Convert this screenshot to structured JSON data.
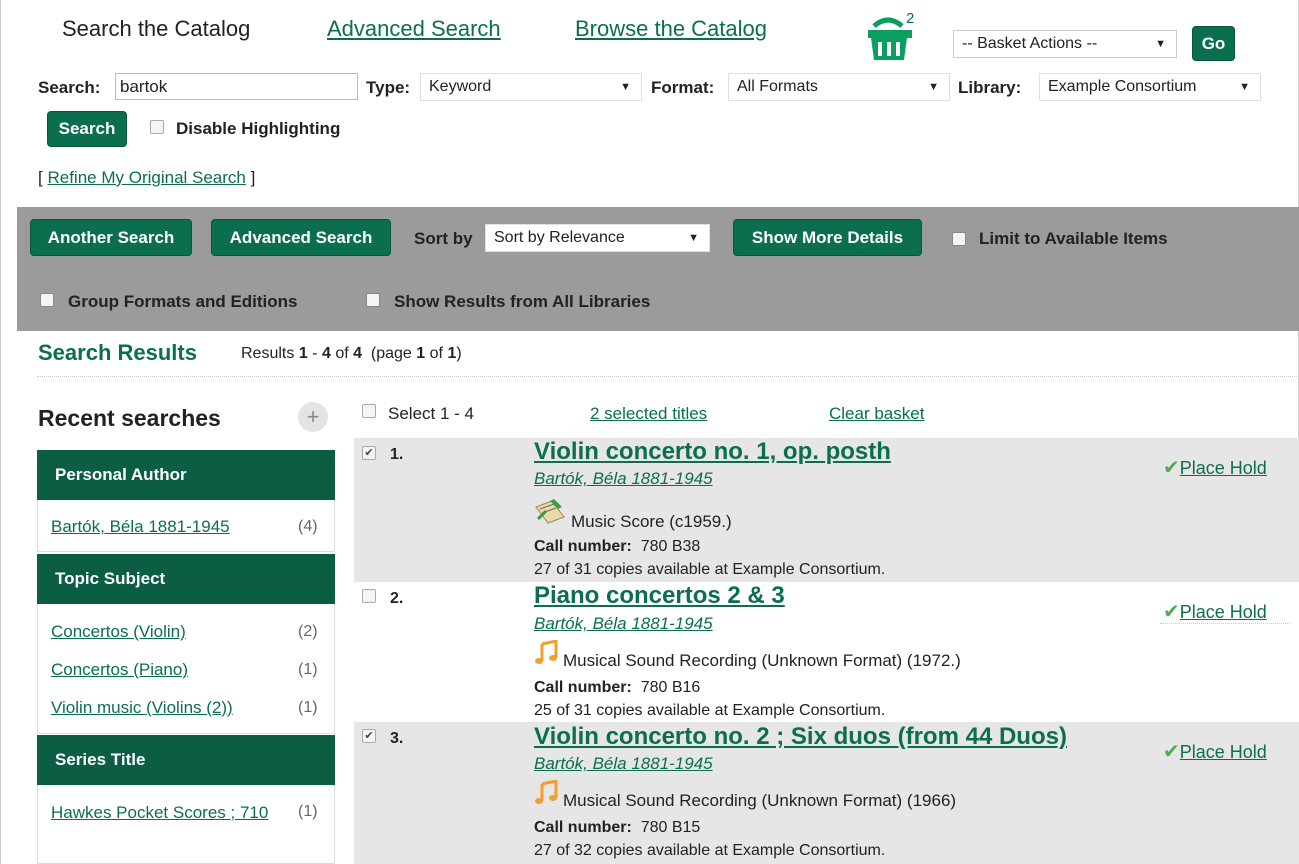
{
  "nav": {
    "search_catalog": "Search the Catalog",
    "advanced_search": "Advanced Search",
    "browse_catalog": "Browse the Catalog",
    "basket_count": "2",
    "basket_actions": "-- Basket Actions --",
    "go_label": "Go"
  },
  "search": {
    "search_label": "Search:",
    "query": "bartok",
    "type_label": "Type:",
    "type_value": "Keyword",
    "format_label": "Format:",
    "format_value": "All Formats",
    "library_label": "Library:",
    "library_value": "Example Consortium",
    "search_button": "Search",
    "disable_highlighting": "Disable Highlighting",
    "refine_open": "[",
    "refine_link": "Refine My Original Search",
    "refine_close": "]"
  },
  "toolbar": {
    "another_search": "Another Search",
    "advanced_search": "Advanced Search",
    "sort_by_label": "Sort by",
    "sort_value": "Sort by Relevance",
    "show_more_details": "Show More Details",
    "limit_available": "Limit to Available Items",
    "group_formats": "Group Formats and Editions",
    "show_all_libraries": "Show Results from All Libraries"
  },
  "results_header": {
    "title": "Search Results",
    "results_prefix": "Results",
    "from": "1",
    "dash": "-",
    "to": "4",
    "of_word": "of",
    "total": "4",
    "page_open": "(page",
    "page": "1",
    "page_of": "of",
    "pages": "1",
    "page_close": ")"
  },
  "sidebar": {
    "recent_searches": "Recent searches",
    "groups": [
      {
        "heading": "Personal Author",
        "items": [
          {
            "label": "Bartók, Béla 1881-1945",
            "count": "(4)"
          }
        ]
      },
      {
        "heading": "Topic Subject",
        "items": [
          {
            "label": "Concertos (Violin)",
            "count": "(2)"
          },
          {
            "label": "Concertos (Piano)",
            "count": "(1)"
          },
          {
            "label": "Violin music (Violins (2))",
            "count": "(1)"
          }
        ]
      },
      {
        "heading": "Series Title",
        "items": [
          {
            "label": "Hawkes Pocket Scores ; 710",
            "count": "(1)"
          }
        ]
      }
    ]
  },
  "list_controls": {
    "select_all": "Select 1 - 4",
    "selected_titles": "2 selected titles",
    "clear_basket": "Clear basket"
  },
  "results": [
    {
      "num": "1.",
      "checked": true,
      "title": "Violin concerto no. 1, op. posth",
      "author": "Bartók, Béla 1881-1945",
      "icon": "music-score-icon",
      "format": "Music Score (c1959.)",
      "call_label": "Call number:",
      "call_number": "780 B38",
      "availability": "27 of 31 copies available at Example Consortium.",
      "hold": "Place Hold"
    },
    {
      "num": "2.",
      "checked": false,
      "title": "Piano concertos 2 & 3",
      "author": "Bartók, Béla 1881-1945",
      "icon": "music-note-icon",
      "format": "Musical Sound Recording (Unknown Format) (1972.)",
      "call_label": "Call number:",
      "call_number": "780 B16",
      "availability": "25 of 31 copies available at Example Consortium.",
      "hold": "Place Hold"
    },
    {
      "num": "3.",
      "checked": true,
      "title": "Violin concerto no. 2 ; Six duos (from 44 Duos)",
      "author": "Bartók, Béla 1881-1945",
      "icon": "music-note-icon",
      "format": "Musical Sound Recording (Unknown Format) (1966)",
      "call_label": "Call number:",
      "call_number": "780 B15",
      "availability": "27 of 32 copies available at Example Consortium.",
      "hold": "Place Hold"
    }
  ],
  "colors": {
    "accent": "#0b6e4f",
    "toolbar_bg": "#9b9b9b",
    "row_shade": "#e6e6e6"
  }
}
